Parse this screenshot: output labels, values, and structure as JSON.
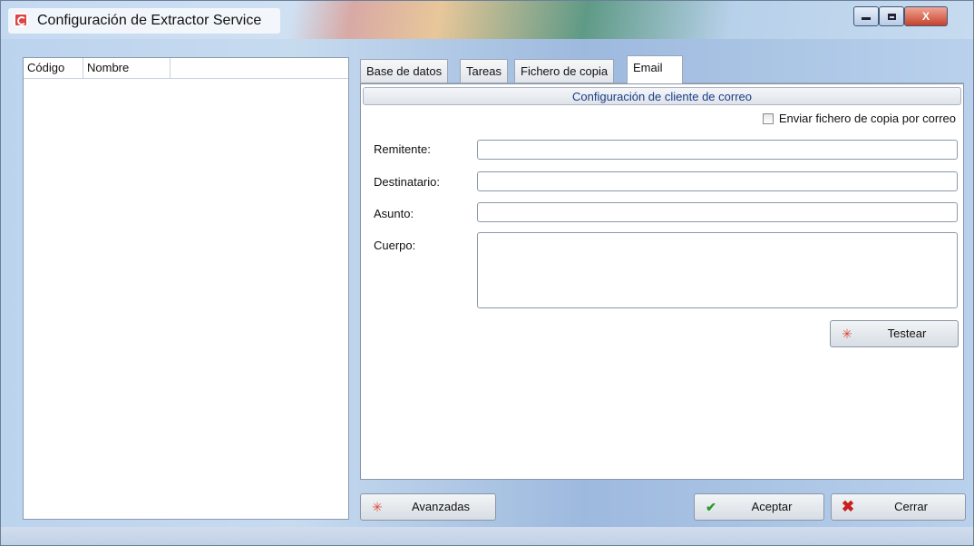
{
  "window": {
    "title": "Configuración de Extractor Service",
    "controls": {
      "minimize": "",
      "maximize": "",
      "close": "X"
    }
  },
  "list": {
    "columns": [
      "Código",
      "Nombre"
    ]
  },
  "tabs": [
    {
      "label": "Base de datos",
      "active": false
    },
    {
      "label": "Tareas",
      "active": false
    },
    {
      "label": "Fichero de copia",
      "active": false
    },
    {
      "label": "Email",
      "active": true
    }
  ],
  "email": {
    "section_title": "Configuración de cliente de correo",
    "send_copy_checkbox": {
      "label": "Enviar fichero de copia por correo",
      "checked": false
    },
    "fields": {
      "remitente": {
        "label": "Remitente:",
        "value": ""
      },
      "destinatario": {
        "label": "Destinatario:",
        "value": ""
      },
      "asunto": {
        "label": "Asunto:",
        "value": ""
      },
      "cuerpo": {
        "label": "Cuerpo:",
        "value": ""
      }
    },
    "test_button": "Testear"
  },
  "footer": {
    "advanced_button": "Avanzadas",
    "accept_button": "Aceptar",
    "close_button": "Cerrar"
  },
  "icons": {
    "star": "✳",
    "check": "✔",
    "cross": "✖"
  },
  "colors": {
    "section_title": "#1a3e86",
    "close_button": "#c7432c"
  }
}
